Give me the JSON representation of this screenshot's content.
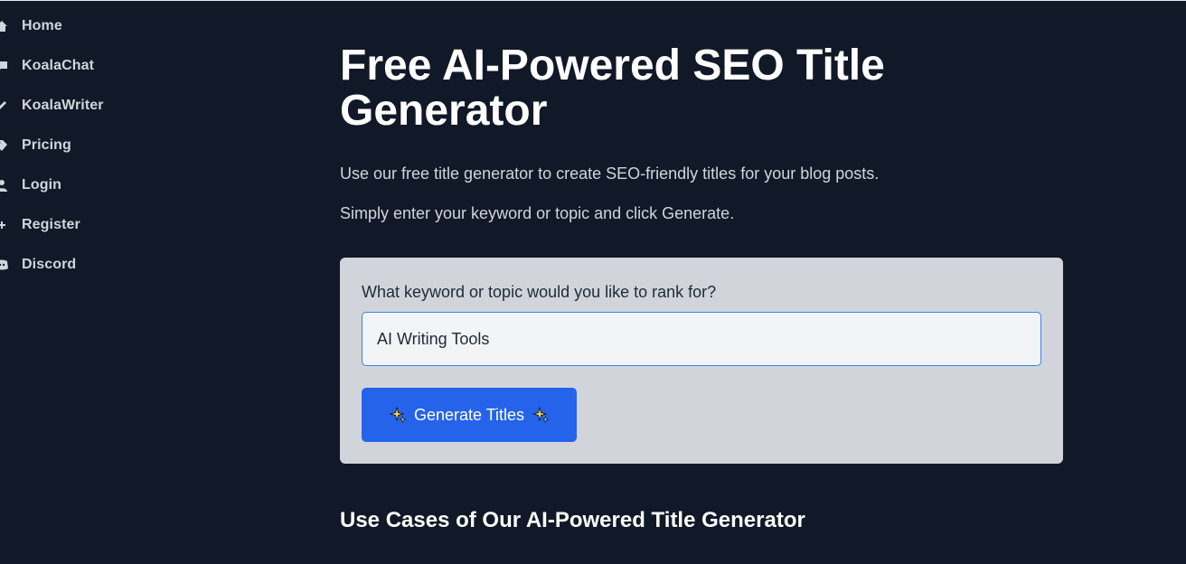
{
  "sidebar": {
    "items": [
      {
        "label": "Home",
        "icon": "home-icon"
      },
      {
        "label": "KoalaChat",
        "icon": "chat-icon"
      },
      {
        "label": "KoalaWriter",
        "icon": "pen-icon"
      },
      {
        "label": "Pricing",
        "icon": "tag-icon"
      },
      {
        "label": "Login",
        "icon": "user-icon"
      },
      {
        "label": "Register",
        "icon": "user-plus-icon"
      },
      {
        "label": "Discord",
        "icon": "discord-icon"
      }
    ]
  },
  "main": {
    "title": "Free AI-Powered SEO Title Generator",
    "intro_1": "Use our free title generator to create SEO-friendly titles for your blog posts.",
    "intro_2": "Simply enter your keyword or topic and click Generate.",
    "form": {
      "label": "What keyword or topic would you like to rank for?",
      "input_value": "AI Writing Tools",
      "button_label": "Generate Titles",
      "button_icon": "sparkles-icon"
    },
    "section_heading": "Use Cases of Our AI-Powered Title Generator"
  },
  "colors": {
    "background": "#111827",
    "card": "#d1d5db",
    "accent": "#2563eb",
    "input_border": "#3b82f6"
  }
}
